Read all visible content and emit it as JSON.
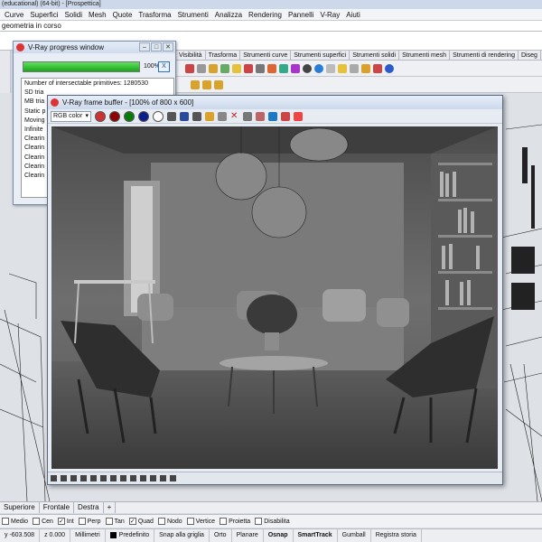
{
  "app": {
    "title": "(educational) (64-bit) - [Prospettica]",
    "menu": [
      "Curve",
      "Superfici",
      "Solidi",
      "Mesh",
      "Quote",
      "Trasforma",
      "Strumenti",
      "Analizza",
      "Rendering",
      "Pannelli",
      "V-Ray",
      "Aiuti"
    ],
    "command_line": "geometria in corso"
  },
  "toolbar_tabs": [
    "Visibilità",
    "Trasforma",
    "Strumenti curve",
    "Strumenti superfici",
    "Strumenti solidi",
    "Strumenti mesh",
    "Strumenti di rendering",
    "Diseg"
  ],
  "progress_window": {
    "title": "V-Ray progress window",
    "percent": 100,
    "percent_label": "100%",
    "cancel_label": "X",
    "log": [
      "Number of intersectable primitives: 1280530",
      "SD tria",
      "MB tria",
      "Static p",
      "Moving",
      "Infinite",
      "Clearin",
      "Clearin",
      "Clearin",
      "Clearin",
      "Clearin"
    ]
  },
  "frame_buffer": {
    "title": "V-Ray frame buffer - [100% of 800 x 600]",
    "channel": "RGB color",
    "channel_buttons": [
      "red",
      "green",
      "blue",
      "white"
    ]
  },
  "viewport_tabs": [
    "Superiore",
    "Frontale",
    "Destra",
    "+"
  ],
  "osnap": [
    {
      "label": "Medio",
      "checked": false
    },
    {
      "label": "Cen",
      "checked": false
    },
    {
      "label": "Int",
      "checked": true
    },
    {
      "label": "Perp",
      "checked": false
    },
    {
      "label": "Tan",
      "checked": false
    },
    {
      "label": "Quad",
      "checked": true
    },
    {
      "label": "Nodo",
      "checked": false
    },
    {
      "label": "Vertice",
      "checked": false
    },
    {
      "label": "Proietta",
      "checked": false
    },
    {
      "label": "Disabilita",
      "checked": false
    }
  ],
  "status": {
    "coord_y": "y -603.508",
    "coord_z": "z 0.000",
    "units": "Millimetri",
    "layer": "Predefinito",
    "snap_grid": "Snap alla griglia",
    "ortho": "Orto",
    "planar": "Planare",
    "osnap": "Osnap",
    "smarttrack": "SmartTrack",
    "gumball": "Gumball",
    "history": "Registra storia"
  },
  "colors": {
    "progress": "#1aa51a",
    "window_border": "#5a6a80"
  }
}
